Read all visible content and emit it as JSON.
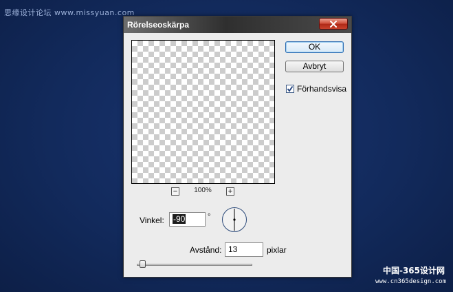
{
  "watermark": {
    "top_left": "思缘设计论坛  www.missyuan.com",
    "bottom_right_cn": "中国-365设计网",
    "bottom_right_url": "www.cn365design.com"
  },
  "dialog": {
    "title": "Rörelseoskärpa",
    "zoom": {
      "minus": "−",
      "plus": "+",
      "level": "100%"
    },
    "buttons": {
      "ok": "OK",
      "cancel": "Avbryt"
    },
    "preview_checkbox": {
      "label": "Förhandsvisa",
      "checked": true
    },
    "angle": {
      "label": "Vinkel:",
      "value": "-90",
      "unit": "°"
    },
    "distance": {
      "label": "Avstånd:",
      "value": "13",
      "unit": "pixlar"
    },
    "slider": {
      "value_fraction": 0.06
    }
  },
  "colors": {
    "background": "#122a5c",
    "close_button": "#c8412b",
    "default_button_border": "#2b6ab0"
  }
}
